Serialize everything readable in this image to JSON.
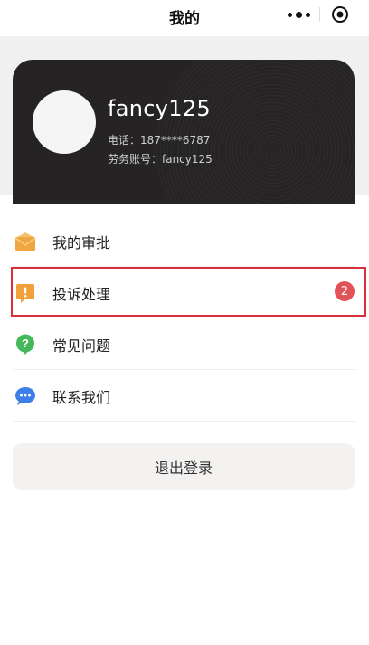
{
  "header": {
    "title": "我的"
  },
  "profile": {
    "username": "fancy125",
    "phone": "电话：187****6787",
    "account": "劳务账号：fancy125"
  },
  "menu": [
    {
      "label": "我的审批",
      "icon": "envelope-icon"
    },
    {
      "label": "投诉处理",
      "icon": "exclamation-icon",
      "badge": "2"
    },
    {
      "label": "常见问题",
      "icon": "question-icon"
    },
    {
      "label": "联系我们",
      "icon": "chat-bubble-icon"
    }
  ],
  "logout_label": "退出登录",
  "colors": {
    "card_bg": "#252323",
    "badge": "#e25358",
    "envelope": "#f0a640",
    "exclamation": "#f2a03c",
    "question": "#45b85b",
    "chat": "#3d7fe8",
    "highlight_border": "#d6313a"
  }
}
